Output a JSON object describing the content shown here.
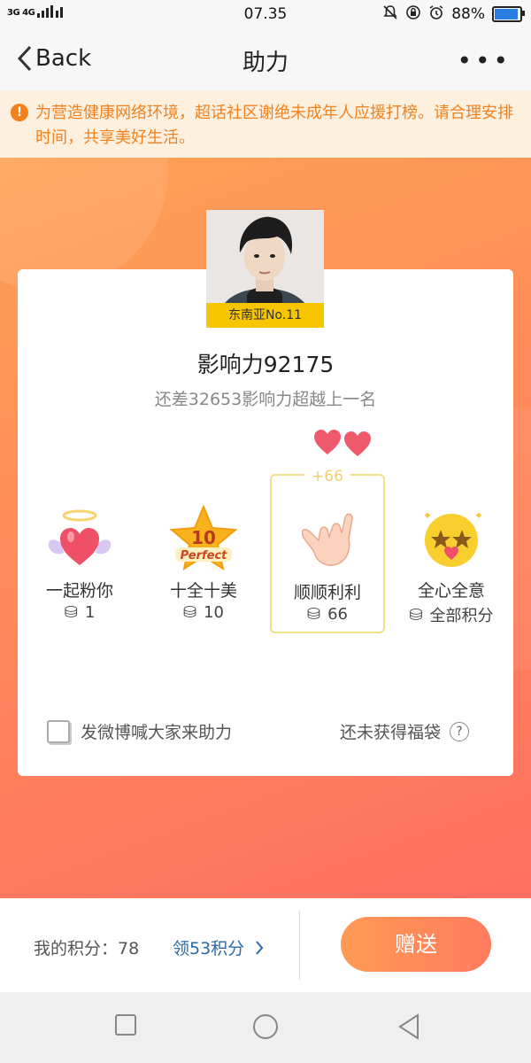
{
  "status": {
    "network": "3G 4G",
    "time": "07.35",
    "battery": "88%",
    "battery_level": 0.88
  },
  "nav": {
    "back_label": "Back",
    "title": "助力"
  },
  "notice": {
    "text": "为营造健康网络环境，超话社区谢绝未成年人应援打榜。请合理安排时间，共享美好生活。"
  },
  "profile": {
    "rank_label": "东南亚No.11"
  },
  "stats": {
    "influence": "影响力92175",
    "gap": "还差32653影响力超越上一名"
  },
  "gifts": [
    {
      "name": "一起粉你",
      "cost": "1",
      "icon": "winged-heart-icon"
    },
    {
      "name": "十全十美",
      "cost": "10",
      "icon": "perfect-10-star-icon",
      "badge_num": "10",
      "badge_text": "Perfect"
    },
    {
      "name": "顺顺利利",
      "cost": "66",
      "icon": "hang-loose-hand-icon",
      "selected": true,
      "plus": "+66"
    },
    {
      "name": "全心全意",
      "cost": "全部积分",
      "icon": "star-eyes-emoji-icon"
    }
  ],
  "share": {
    "label": "发微博喊大家来助力"
  },
  "lucky_bag": {
    "label": "还未获得福袋"
  },
  "bottom": {
    "points_label": "我的积分：78",
    "claim_label": "领53积分",
    "give_label": "赠送"
  },
  "colors": {
    "accent": "#ff8a5a",
    "notice": "#f2811d",
    "link": "#2a6aa6",
    "rank_badge": "#f8c600"
  }
}
